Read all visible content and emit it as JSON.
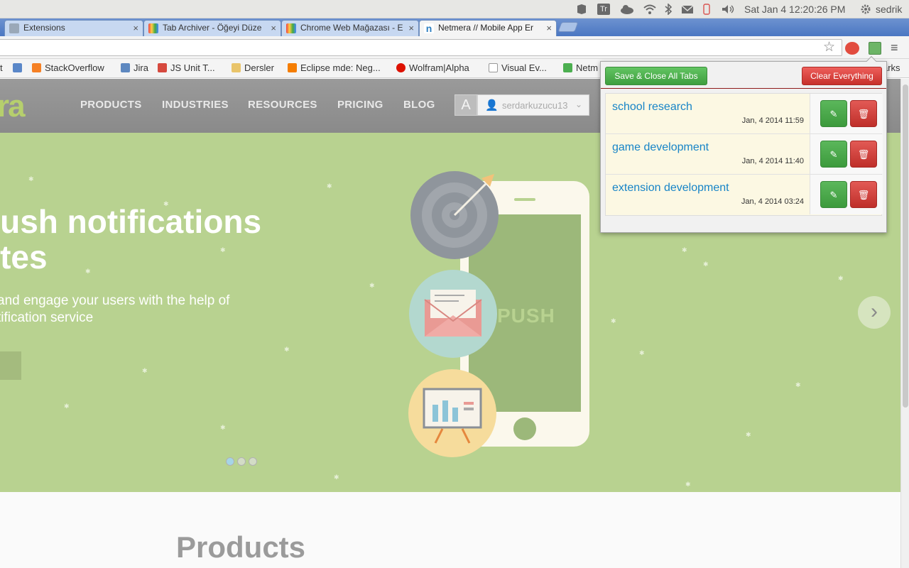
{
  "system_bar": {
    "datetime": "Sat Jan 4 12:20:26 PM",
    "user": "sedrik",
    "indicators": [
      "dropbox-icon",
      "trello-icon",
      "cloud-icon",
      "wifi-icon",
      "bluetooth-icon",
      "mail-icon",
      "battery-icon",
      "volume-icon"
    ]
  },
  "tabs": [
    {
      "title": "Extensions",
      "close": "×"
    },
    {
      "title": "Tab Archiver - Öğeyi Düze",
      "close": "×"
    },
    {
      "title": "Chrome Web Mağazası - E",
      "close": "×"
    },
    {
      "title": "Netmera // Mobile App Er",
      "close": "×"
    }
  ],
  "bookmarks": [
    {
      "label": "t"
    },
    {
      "label": ""
    },
    {
      "label": "StackOverflow"
    },
    {
      "label": "Jira"
    },
    {
      "label": "JS Unit T..."
    },
    {
      "label": "Dersler"
    },
    {
      "label": "Eclipse mde: Neg..."
    },
    {
      "label": "Wolfram|Alpha"
    },
    {
      "label": "Visual Ev..."
    },
    {
      "label": "Netm"
    },
    {
      "label": "arks"
    }
  ],
  "site": {
    "logo": "ra",
    "nav": [
      "PRODUCTS",
      "INDUSTRIES",
      "RESOURCES",
      "PRICING",
      "BLOG"
    ],
    "username": "serdarkuzucu13",
    "hero_title_1": "push notifications",
    "hero_title_2": "utes",
    "hero_sub_1": "and engage your users with the help of",
    "hero_sub_2": "tification service",
    "phone_label": "PUSH",
    "next_arrow": "›",
    "products_heading": "Products"
  },
  "popup": {
    "save_label": "Save & Close All Tabs",
    "clear_label": "Clear Everything",
    "archives": [
      {
        "name": "school research",
        "date": "Jan, 4 2014 11:59"
      },
      {
        "name": "game development",
        "date": "Jan, 4 2014 11:40"
      },
      {
        "name": "extension development",
        "date": "Jan, 4 2014 03:24"
      }
    ]
  },
  "colors": {
    "hero_green": "#b8d290",
    "popup_green": "#5bb75b",
    "popup_red": "#d9534f",
    "link_blue": "#1784c7"
  }
}
